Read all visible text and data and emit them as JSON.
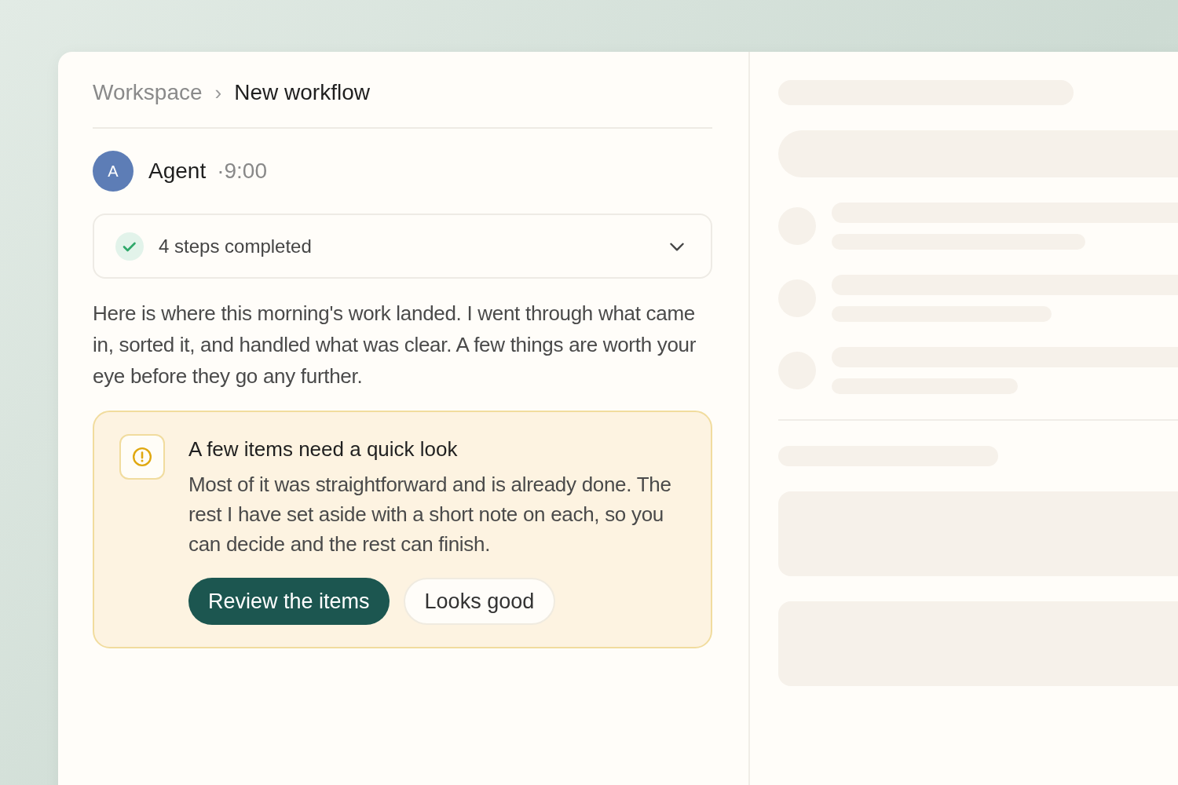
{
  "breadcrumb": [
    {
      "label": "Workspace",
      "current": false
    },
    {
      "label": "New workflow",
      "current": true
    }
  ],
  "breadcrumb_separator": "›",
  "message": {
    "avatar": "A",
    "author": "Agent",
    "time": "·9:00"
  },
  "steps": {
    "label": "4 steps completed",
    "expanded": false
  },
  "body": "Here is where this morning's work landed. I went through what came in, sorted it, and handled what was clear. A few things are worth your eye before they go any further.",
  "notice": {
    "title": "A few items need a quick look",
    "text": "Most of it was straightforward and is already done. The rest I have set aside with a short note on each, so you can decide and the rest can finish.",
    "actions": [
      {
        "label": "Review the items",
        "kind": "primary"
      },
      {
        "label": "Looks good",
        "kind": "secondary"
      }
    ]
  }
}
